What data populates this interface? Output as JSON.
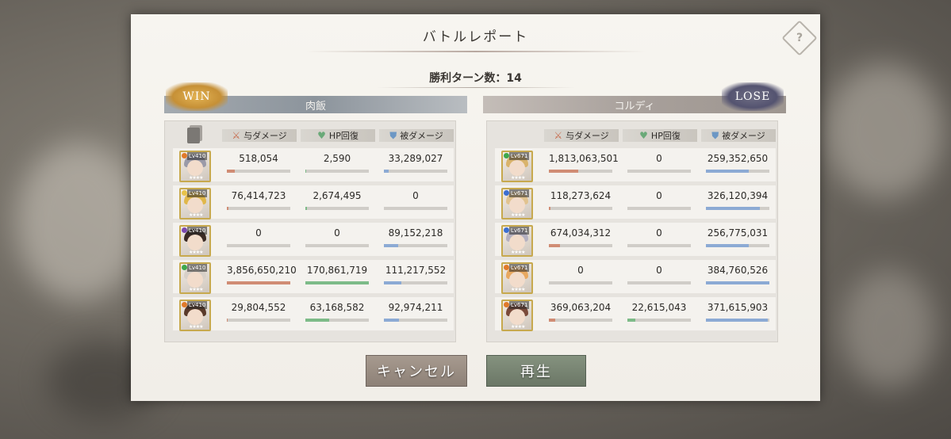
{
  "dialog": {
    "title": "バトルレポート",
    "turns_label": "勝利ターン数：14"
  },
  "columns": {
    "damage": "与ダメージ",
    "heal": "HP回復",
    "taken": "被ダメージ"
  },
  "left_team": {
    "name": "肉飯",
    "result": "WIN",
    "members": [
      {
        "level": "Lv410",
        "element": "fire",
        "damage": "518,054",
        "damage_pct": 0.13,
        "heal": "2,590",
        "heal_pct": 0.01,
        "taken": "33,289,027",
        "taken_pct": 0.08
      },
      {
        "level": "Lv410",
        "element": "light",
        "damage": "76,414,723",
        "damage_pct": 0.02,
        "heal": "2,674,495",
        "heal_pct": 0.02,
        "taken": "0",
        "taken_pct": 0.0
      },
      {
        "level": "Lv410",
        "element": "dark",
        "damage": "0",
        "damage_pct": 0.0,
        "heal": "0",
        "heal_pct": 0.0,
        "taken": "89,152,218",
        "taken_pct": 0.22
      },
      {
        "level": "Lv410",
        "element": "wind",
        "damage": "3,856,650,210",
        "damage_pct": 1.0,
        "heal": "170,861,719",
        "heal_pct": 1.0,
        "taken": "111,217,552",
        "taken_pct": 0.28
      },
      {
        "level": "Lv410",
        "element": "fire",
        "damage": "29,804,552",
        "damage_pct": 0.01,
        "heal": "63,168,582",
        "heal_pct": 0.37,
        "taken": "92,974,211",
        "taken_pct": 0.24
      }
    ]
  },
  "right_team": {
    "name": "コルディ",
    "result": "LOSE",
    "members": [
      {
        "level": "Lv671",
        "element": "wind",
        "damage": "1,813,063,501",
        "damage_pct": 0.46,
        "heal": "0",
        "heal_pct": 0.0,
        "taken": "259,352,650",
        "taken_pct": 0.67
      },
      {
        "level": "Lv671",
        "element": "water",
        "damage": "118,273,624",
        "damage_pct": 0.03,
        "heal": "0",
        "heal_pct": 0.0,
        "taken": "326,120,394",
        "taken_pct": 0.85
      },
      {
        "level": "Lv671",
        "element": "water",
        "damage": "674,034,312",
        "damage_pct": 0.17,
        "heal": "0",
        "heal_pct": 0.0,
        "taken": "256,775,031",
        "taken_pct": 0.67
      },
      {
        "level": "Lv671",
        "element": "fire",
        "damage": "0",
        "damage_pct": 0.0,
        "heal": "0",
        "heal_pct": 0.0,
        "taken": "384,760,526",
        "taken_pct": 1.0
      },
      {
        "level": "Lv671",
        "element": "fire",
        "damage": "369,063,204",
        "damage_pct": 0.1,
        "heal": "22,615,043",
        "heal_pct": 0.13,
        "taken": "371,615,903",
        "taken_pct": 0.97
      }
    ]
  },
  "buttons": {
    "cancel": "キャンセル",
    "play": "再生"
  },
  "colors": {
    "damage": "#d08c74",
    "heal": "#7dbb88",
    "taken": "#8caad4",
    "fire": "#e07a2a",
    "water": "#3c6fd1",
    "wind": "#3ea84c",
    "light": "#e8c34a",
    "dark": "#7b4ab0"
  }
}
